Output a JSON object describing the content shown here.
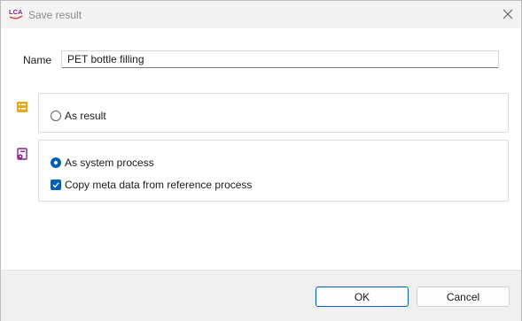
{
  "window": {
    "title": "Save result",
    "app_icon": "lca-logo-icon",
    "app_icon_text": "LCA",
    "close_icon": "close-icon"
  },
  "form": {
    "name_label": "Name",
    "name_value": "PET bottle filling"
  },
  "options": {
    "as_result": {
      "icon": "result-list-icon",
      "label": "As result",
      "selected": false
    },
    "as_system_process": {
      "icon": "system-process-icon",
      "label": "As system process",
      "selected": true
    },
    "copy_meta_data": {
      "label": "Copy meta data from reference process",
      "checked": true
    }
  },
  "buttons": {
    "ok_label": "OK",
    "cancel_label": "Cancel"
  },
  "colors": {
    "accent": "#005fb8",
    "result_icon": "#e6a817",
    "system_process_icon": "#8b1d8b"
  }
}
